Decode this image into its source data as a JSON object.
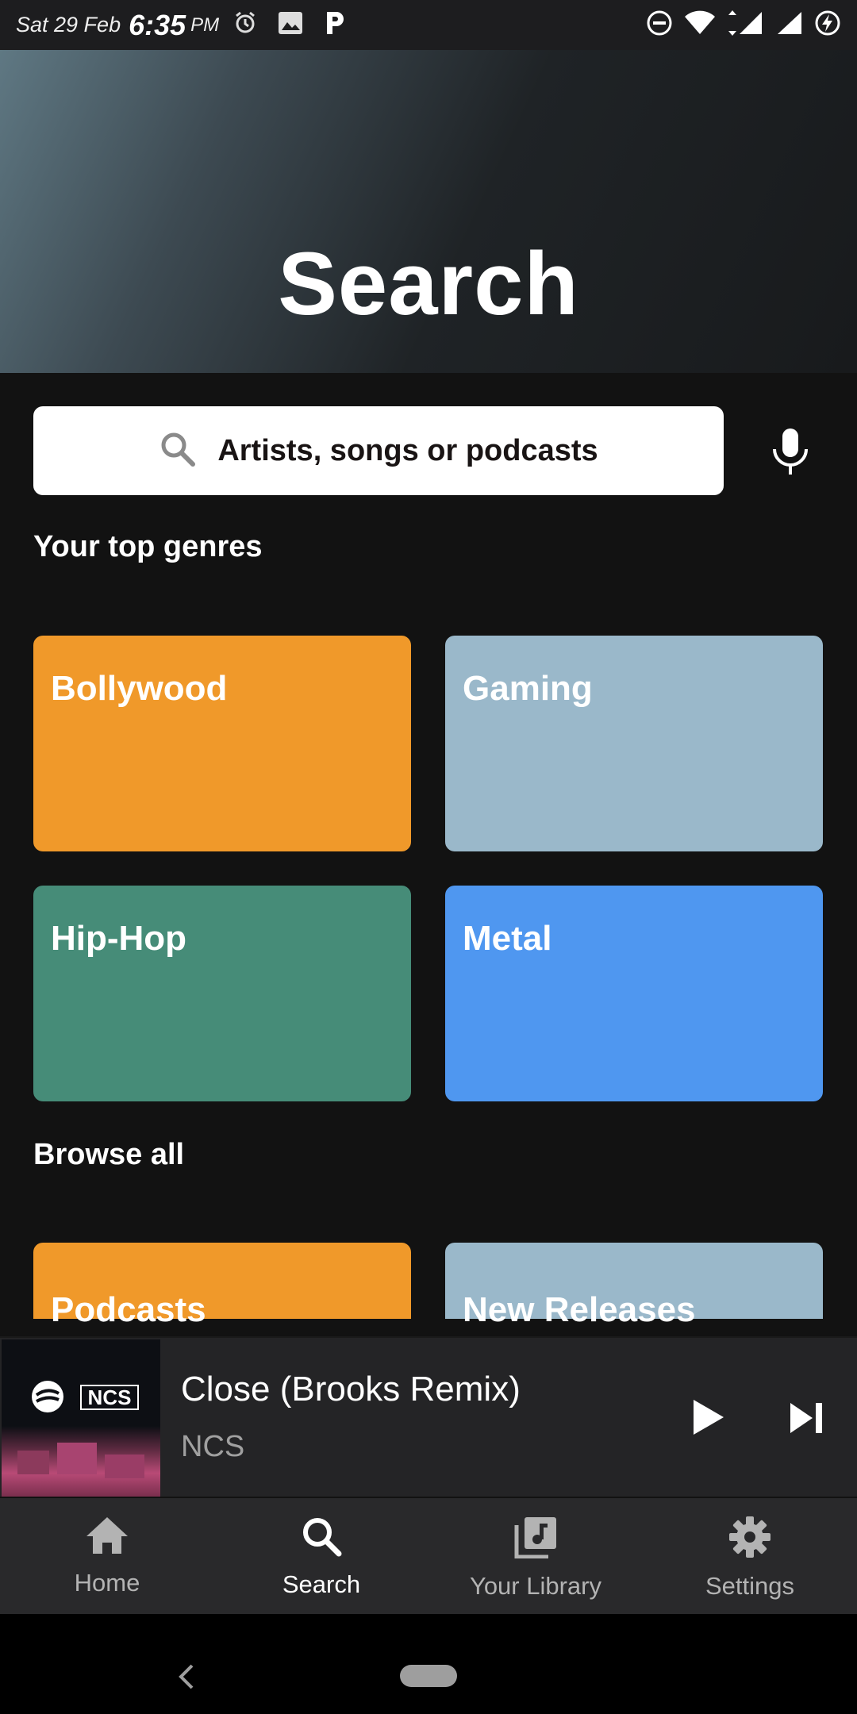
{
  "status_bar": {
    "date": "Sat 29 Feb",
    "time": "6:35",
    "ampm": "PM",
    "icons_left": [
      "alarm-icon",
      "image-icon",
      "p-app-icon"
    ],
    "icons_right": [
      "do-not-disturb-icon",
      "wifi-icon",
      "signal-icon",
      "signal-icon",
      "battery-charging-icon"
    ]
  },
  "header": {
    "title": "Search"
  },
  "search": {
    "placeholder": "Artists, songs or podcasts"
  },
  "top_genres": {
    "title": "Your top genres",
    "items": [
      {
        "label": "Bollywood",
        "color": "#f0992a"
      },
      {
        "label": "Gaming",
        "color": "#9ab8ca"
      },
      {
        "label": "Hip-Hop",
        "color": "#468c78"
      },
      {
        "label": "Metal",
        "color": "#4f97f0"
      }
    ]
  },
  "browse_all": {
    "title": "Browse all",
    "items": [
      {
        "label": "Podcasts",
        "color": "#f0992a"
      },
      {
        "label": "New Releases",
        "color": "#9ab8ca"
      }
    ]
  },
  "now_playing": {
    "title": "Close (Brooks Remix)",
    "artist": "NCS",
    "album_logo_text": "NCS"
  },
  "bottom_nav": {
    "items": [
      {
        "label": "Home",
        "icon": "home-icon",
        "active": false
      },
      {
        "label": "Search",
        "icon": "search-icon",
        "active": true
      },
      {
        "label": "Your Library",
        "icon": "library-icon",
        "active": false
      },
      {
        "label": "Settings",
        "icon": "gear-icon",
        "active": false
      }
    ]
  }
}
